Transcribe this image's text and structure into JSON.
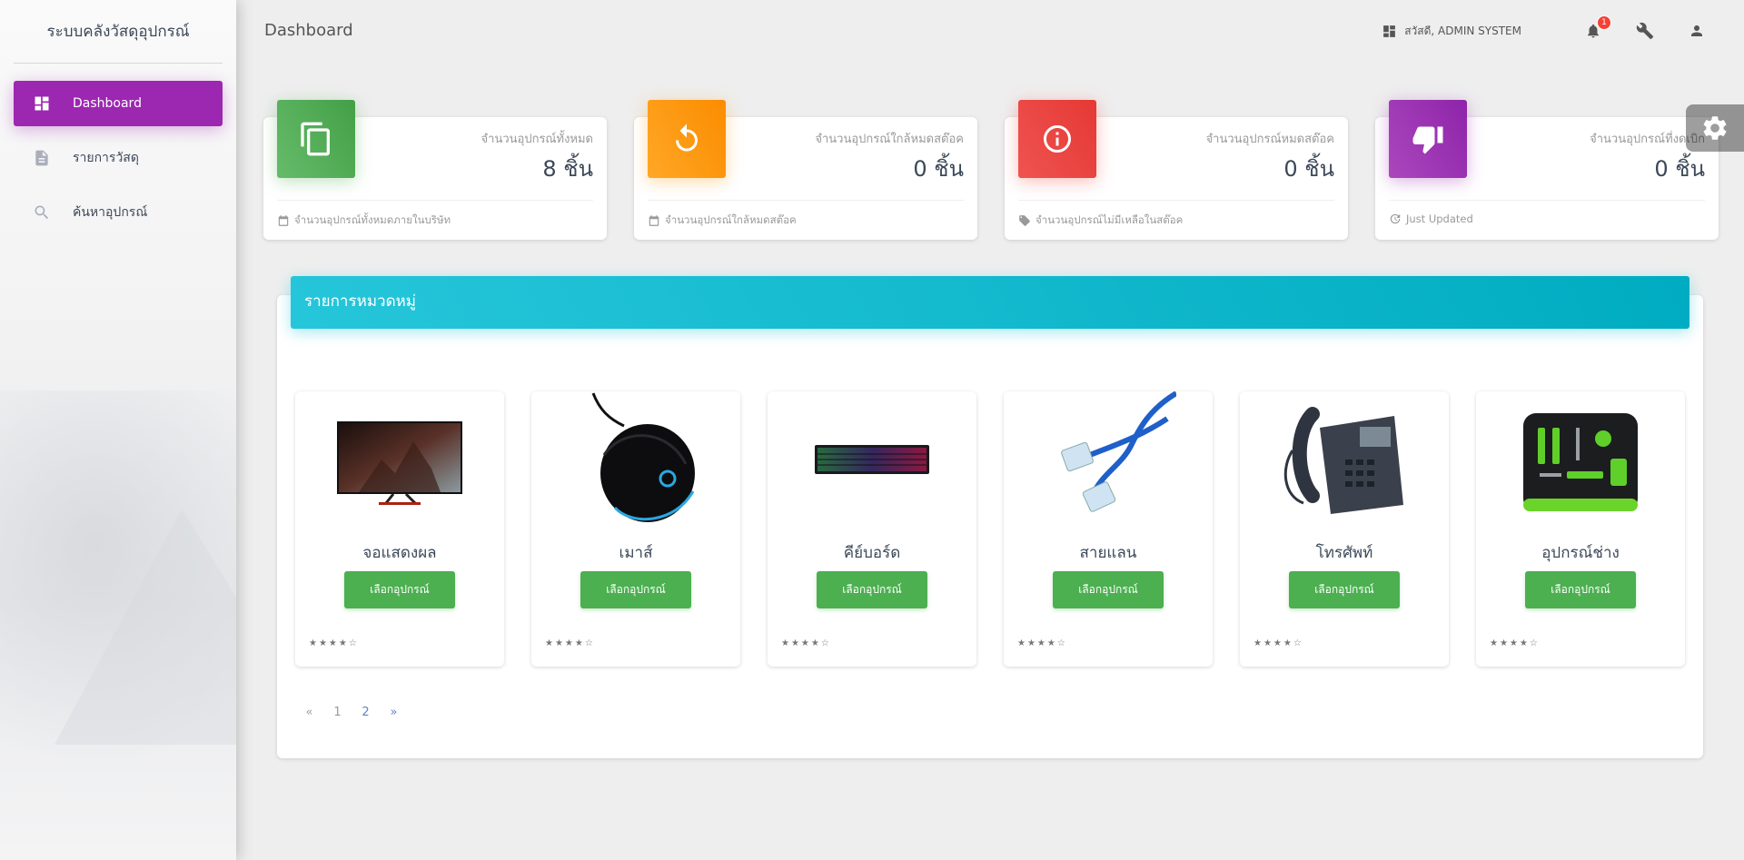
{
  "app": {
    "brand": "ระบบคลังวัสดุอุปกรณ์"
  },
  "sidebar": {
    "items": [
      {
        "label": "Dashboard",
        "icon": "dashboard-icon",
        "active": true
      },
      {
        "label": "รายการวัสดุ",
        "icon": "document-icon",
        "active": false
      },
      {
        "label": "ค้นหาอุปกรณ์",
        "icon": "search-icon",
        "active": false
      }
    ]
  },
  "header": {
    "title": "Dashboard",
    "greeting": "สวัสดี, ADMIN SYSTEM",
    "notification_count": "1"
  },
  "stats": [
    {
      "category": "จำนวนอุปกรณ์ทั้งหมด",
      "value": "8 ชิ้น",
      "footer": "จำนวนอุปกรณ์ทั้งหมดภายในบริษัท",
      "color": "#4caf50",
      "icon": "copy-icon",
      "footer_icon": "calendar-icon"
    },
    {
      "category": "จำนวนอุปกรณ์ใกล้หมดสต๊อค",
      "value": "0 ชิ้น",
      "footer": "จำนวนอุปกรณ์ใกล้หมดสต๊อค",
      "color": "#ff9800",
      "icon": "refresh-icon",
      "footer_icon": "calendar-icon"
    },
    {
      "category": "จำนวนอุปกรณ์หมดสต๊อค",
      "value": "0 ชิ้น",
      "footer": "จำนวนอุปกรณ์ไม่มีเหลือในสต๊อค",
      "color": "#f44336",
      "icon": "info-icon",
      "footer_icon": "tag-icon"
    },
    {
      "category": "จำนวนอุปกรณ์ที่งดเบิก",
      "value": "0 ชิ้น",
      "footer": "Just Updated",
      "color": "#9c27b0",
      "icon": "thumbs-down-icon",
      "footer_icon": "update-icon"
    }
  ],
  "category_panel": {
    "title": "รายการหมวดหมู่",
    "button_label": "เลือกอุปกรณ์",
    "items": [
      {
        "name": "จอแสดงผล",
        "image": "monitor-image",
        "rating": "★★★★☆"
      },
      {
        "name": "เมาส์",
        "image": "mouse-image",
        "rating": "★★★★☆"
      },
      {
        "name": "คีย์บอร์ด",
        "image": "keyboard-image",
        "rating": "★★★★☆"
      },
      {
        "name": "สายแลน",
        "image": "lan-cable-image",
        "rating": "★★★★☆"
      },
      {
        "name": "โทรศัพท์",
        "image": "phone-image",
        "rating": "★★★★☆"
      },
      {
        "name": "อุปกรณ์ช่าง",
        "image": "toolkit-image",
        "rating": "★★★★☆"
      }
    ]
  },
  "pagination": {
    "prev": "«",
    "pages": [
      "1",
      "2"
    ],
    "next": "»",
    "current": "2"
  }
}
